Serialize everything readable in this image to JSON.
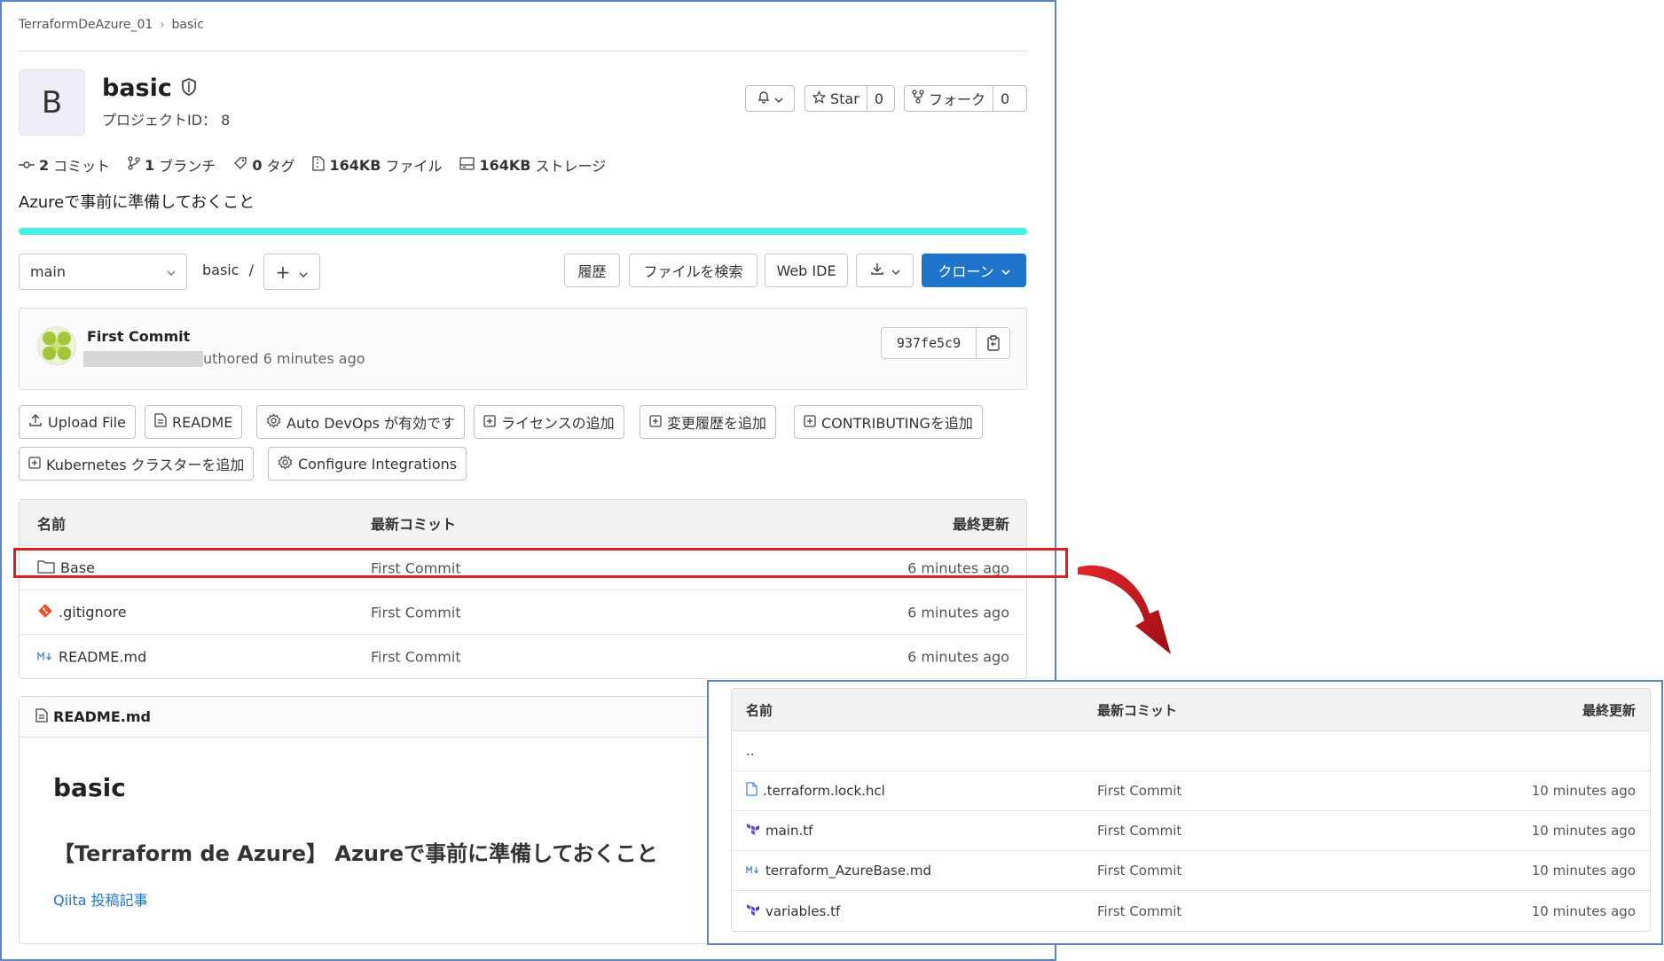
{
  "breadcrumb": {
    "parent": "TerraformDeAzure_01",
    "current": "basic"
  },
  "project": {
    "avatar_letter": "B",
    "name": "basic",
    "id_label": "プロジェクトID： 8"
  },
  "actions": {
    "star_label": "Star",
    "star_count": "0",
    "fork_label": "フォーク",
    "fork_count": "0"
  },
  "stats": {
    "commits_count": "2",
    "commits_label": "コミット",
    "branches_count": "1",
    "branches_label": "ブランチ",
    "tags_count": "0",
    "tags_label": "タグ",
    "files_size": "164KB",
    "files_label": "ファイル",
    "storage_size": "164KB",
    "storage_label": "ストレージ"
  },
  "description": "Azureで事前に準備しておくこと",
  "toolbar": {
    "branch": "main",
    "path": "basic",
    "path_sep": "/",
    "history": "履歴",
    "find_file": "ファイルを検索",
    "web_ide": "Web IDE",
    "clone": "クローン"
  },
  "last_commit": {
    "title": "First Commit",
    "meta": "uthored 6 minutes ago",
    "sha": "937fe5c9"
  },
  "quick_actions": [
    "Upload File",
    "README",
    "Auto DevOps が有効です",
    "ライセンスの追加",
    "変更履歴を追加",
    "CONTRIBUTINGを追加",
    "Kubernetes クラスターを追加",
    "Configure Integrations"
  ],
  "file_table": {
    "headers": {
      "name": "名前",
      "commit": "最新コミット",
      "updated": "最終更新"
    },
    "rows": [
      {
        "name": "Base",
        "commit": "First Commit",
        "updated": "6 minutes ago",
        "icon": "folder-icon"
      },
      {
        "name": ".gitignore",
        "commit": "First Commit",
        "updated": "6 minutes ago",
        "icon": "git-icon"
      },
      {
        "name": "README.md",
        "commit": "First Commit",
        "updated": "6 minutes ago",
        "icon": "markdown-icon"
      }
    ]
  },
  "readme": {
    "filename": "README.md",
    "h1": "basic",
    "h2": "【Terraform de Azure】 Azureで事前に準備しておくこと",
    "link": "Qiita 投稿記事"
  },
  "zoom_table": {
    "headers": {
      "name": "名前",
      "commit": "最新コミット",
      "updated": "最終更新"
    },
    "parent_row": "..",
    "rows": [
      {
        "name": ".terraform.lock.hcl",
        "commit": "First Commit",
        "updated": "10 minutes ago",
        "icon": "file-icon"
      },
      {
        "name": "main.tf",
        "commit": "First Commit",
        "updated": "10 minutes ago",
        "icon": "terraform-icon"
      },
      {
        "name": "terraform_AzureBase.md",
        "commit": "First Commit",
        "updated": "10 minutes ago",
        "icon": "markdown-icon"
      },
      {
        "name": "variables.tf",
        "commit": "First Commit",
        "updated": "10 minutes ago",
        "icon": "terraform-icon"
      }
    ]
  },
  "colors": {
    "primary": "#1f75cb",
    "progress": "#45f0e8",
    "highlight": "#e02020",
    "frame": "#5b83c8",
    "arrow": "#c0141a"
  }
}
